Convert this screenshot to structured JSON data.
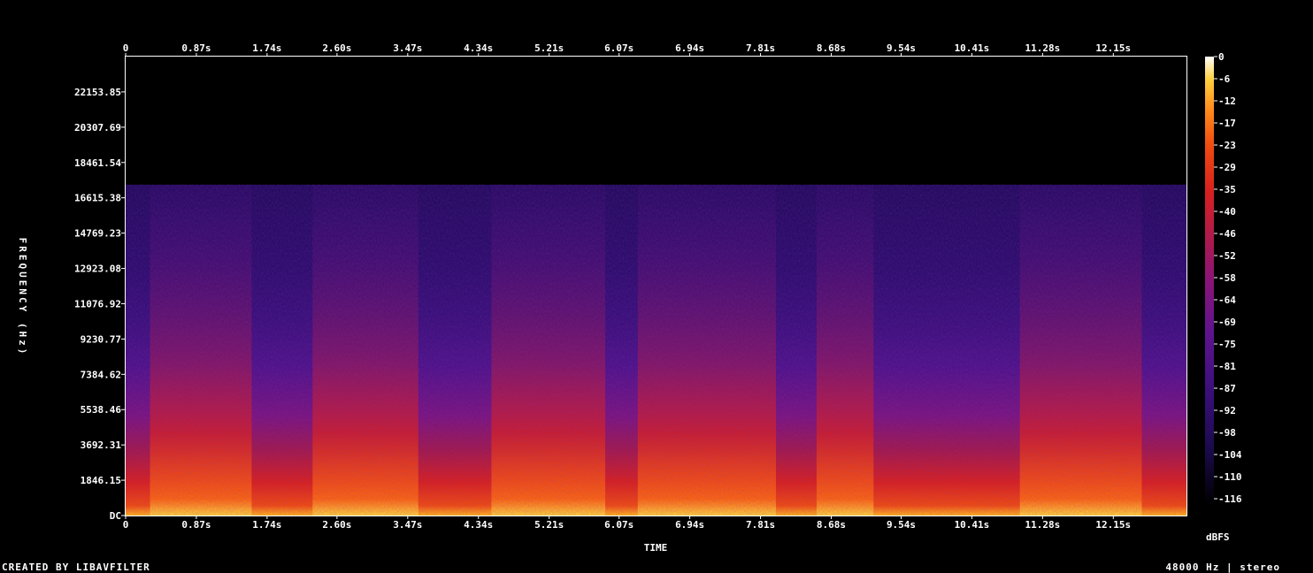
{
  "chart_data": {
    "type": "heatmap",
    "kind": "spectrogram",
    "x_ticks": [
      "0",
      "0.87s",
      "1.74s",
      "2.60s",
      "3.47s",
      "4.34s",
      "5.21s",
      "6.07s",
      "6.94s",
      "7.81s",
      "8.68s",
      "9.54s",
      "10.41s",
      "11.28s",
      "12.15s"
    ],
    "x_tick_values": [
      0,
      0.87,
      1.74,
      2.6,
      3.47,
      4.34,
      5.21,
      6.07,
      6.94,
      7.81,
      8.68,
      9.54,
      10.41,
      11.28,
      12.15
    ],
    "x_range": [
      0,
      13.05
    ],
    "y_ticks": [
      "DC",
      "1846.15",
      "3692.31",
      "5538.46",
      "7384.62",
      "9230.77",
      "11076.92",
      "12923.08",
      "14769.23",
      "16615.38",
      "18461.54",
      "20307.69",
      "22153.85"
    ],
    "y_tick_values": [
      0,
      1846.15,
      3692.31,
      5538.46,
      7384.62,
      9230.77,
      11076.92,
      12923.08,
      14769.23,
      16615.38,
      18461.54,
      20307.69,
      22153.85
    ],
    "y_range": [
      0,
      24000
    ],
    "xlabel": "TIME",
    "ylabel": "FREQUENCY (Hz)",
    "colorbar_label": "dBFS",
    "colorbar_ticks": [
      "0",
      "-6",
      "-12",
      "-17",
      "-23",
      "-29",
      "-35",
      "-40",
      "-46",
      "-52",
      "-58",
      "-64",
      "-69",
      "-75",
      "-81",
      "-87",
      "-92",
      "-98",
      "-104",
      "-110",
      "-116"
    ],
    "colorbar_range": [
      -120,
      0
    ],
    "cutoff_frequency_hz": 17300,
    "loud_time_segments_s": [
      0.3,
      1.55,
      2.3,
      3.6,
      4.5,
      5.9,
      6.3,
      8.0,
      8.5,
      9.2,
      11.0,
      12.5,
      13.0
    ]
  },
  "colors": {
    "background": "#000000",
    "colormap": [
      "#000000",
      "#1a0a4a",
      "#3a0f7a",
      "#5e138e",
      "#8a1478",
      "#b01a4a",
      "#d8201e",
      "#f04a10",
      "#ff8a1a",
      "#ffd040",
      "#ffffff"
    ]
  },
  "footer": {
    "left": "CREATED BY LIBAVFILTER",
    "right": "48000 Hz | stereo"
  }
}
